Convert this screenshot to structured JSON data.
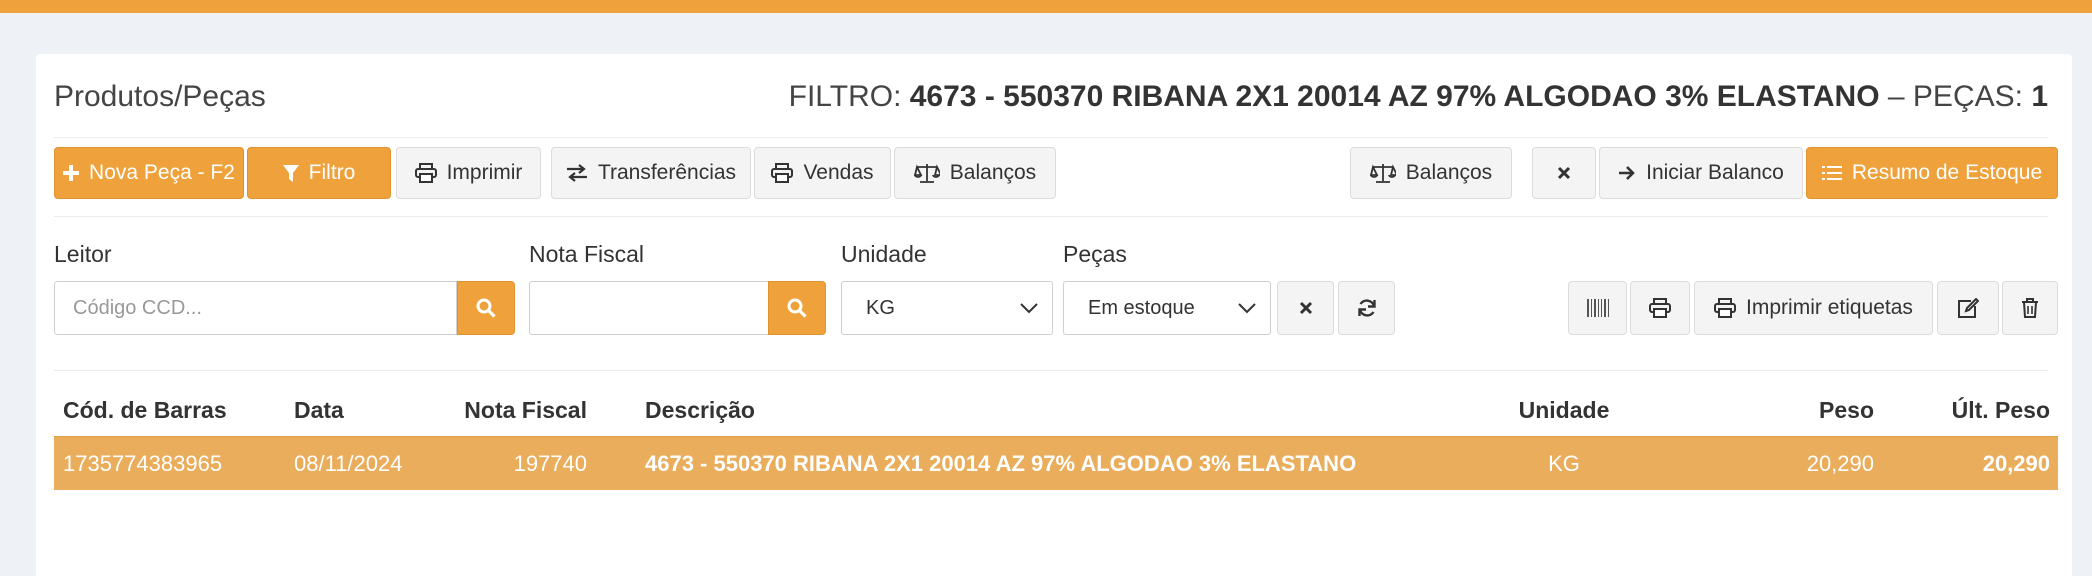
{
  "header": {
    "title": "Produtos/Peças",
    "filter_label": "FILTRO:",
    "filter_value": "4673 - 550370 RIBANA 2X1 20014 AZ 97% ALGODAO 3% ELASTANO",
    "pieces_label": "– PEÇAS:",
    "pieces_count": "1"
  },
  "toolbar": {
    "new_piece": "Nova Peça - F2",
    "filter": "Filtro",
    "print": "Imprimir",
    "transfers": "Transferências",
    "sales": "Vendas",
    "balances": "Balanços",
    "balances_right": "Balanços",
    "start_balance": "Iniciar Balanco",
    "stock_summary": "Resumo de Estoque"
  },
  "filters": {
    "reader_label": "Leitor",
    "reader_placeholder": "Código CCD...",
    "reader_value": "",
    "invoice_label": "Nota Fiscal",
    "invoice_value": "",
    "unit_label": "Unidade",
    "unit_selected": "KG",
    "pieces_label": "Peças",
    "pieces_selected": "Em estoque"
  },
  "actions": {
    "print_labels": "Imprimir etiquetas"
  },
  "table": {
    "columns": {
      "barcode": "Cód. de Barras",
      "date": "Data",
      "invoice": "Nota Fiscal",
      "description": "Descrição",
      "unit": "Unidade",
      "weight": "Peso",
      "last_weight": "Últ. Peso"
    },
    "rows": [
      {
        "barcode": "1735774383965",
        "date": "08/11/2024",
        "invoice": "197740",
        "description": "4673 - 550370 RIBANA 2X1 20014 AZ 97% ALGODAO 3% ELASTANO",
        "unit": "KG",
        "weight": "20,290",
        "last_weight": "20,290"
      }
    ]
  },
  "colors": {
    "accent": "#efa23b",
    "selected_row": "#e9ad5b",
    "background": "#eef1f5"
  }
}
